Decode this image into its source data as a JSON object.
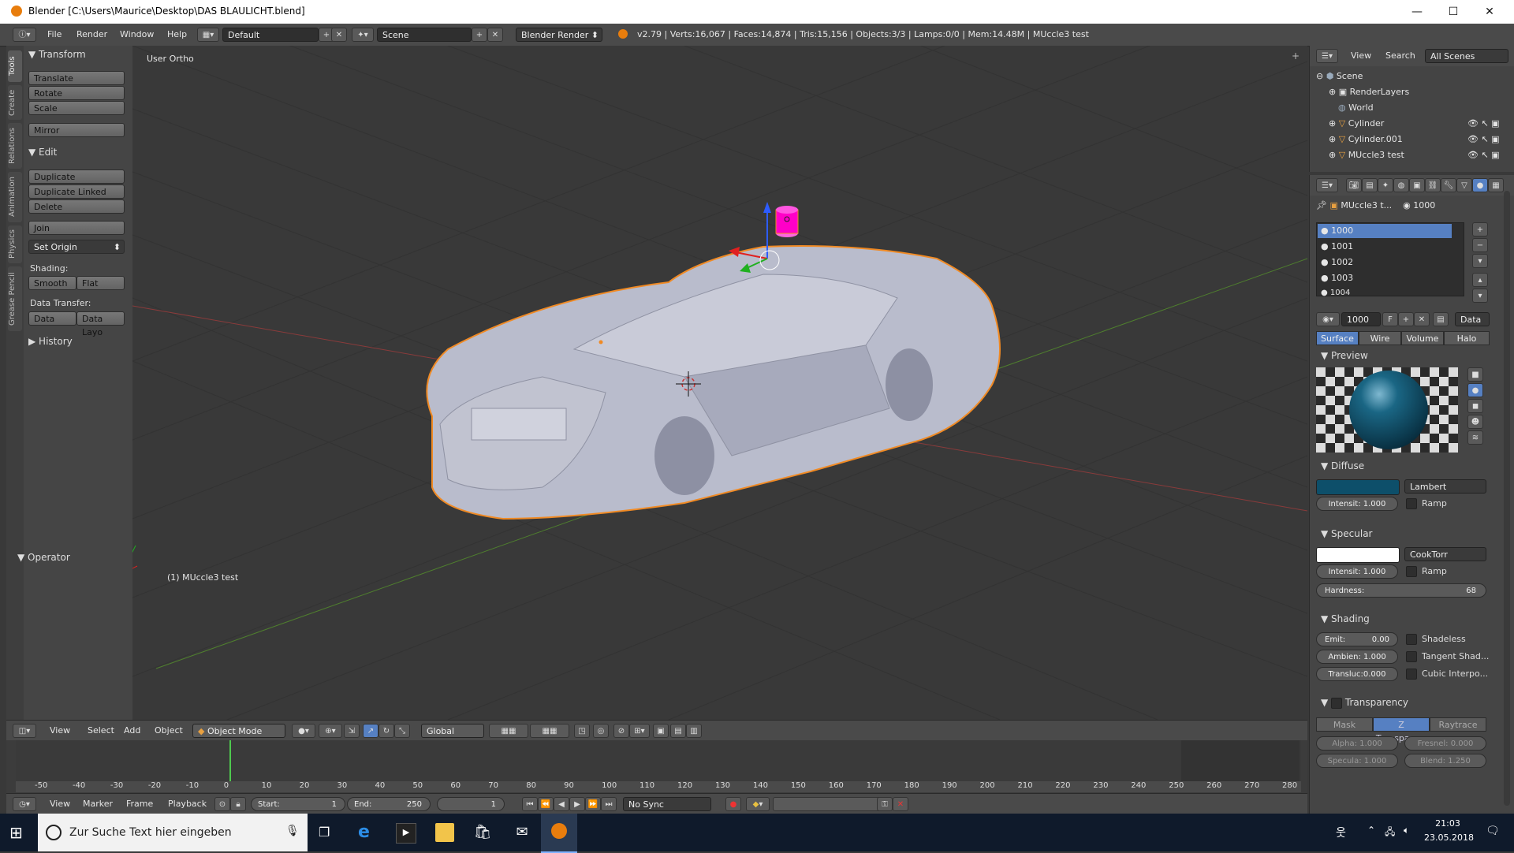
{
  "window": {
    "title": "Blender [C:\\Users\\Maurice\\Desktop\\DAS BLAULICHT.blend]",
    "minimize": "—",
    "maximize": "☐",
    "close": "✕"
  },
  "info_header": {
    "menus": [
      "File",
      "Render",
      "Window",
      "Help"
    ],
    "layout": "Default",
    "scene": "Scene",
    "engine": "Blender Render",
    "stats": "v2.79 | Verts:16,067 | Faces:14,874 | Tris:15,156 | Objects:3/3 | Lamps:0/0 | Mem:14.48M | MUccle3 test"
  },
  "tool_tabs": [
    "Tools",
    "Create",
    "Relations",
    "Animation",
    "Physics",
    "Grease Pencil"
  ],
  "tool_shelf": {
    "transform_title": "Transform",
    "translate": "Translate",
    "rotate": "Rotate",
    "scale": "Scale",
    "mirror": "Mirror",
    "edit_title": "Edit",
    "duplicate": "Duplicate",
    "duplicate_linked": "Duplicate Linked",
    "delete": "Delete",
    "join": "Join",
    "set_origin": "Set Origin",
    "shading_label": "Shading:",
    "smooth": "Smooth",
    "flat": "Flat",
    "data_transfer_label": "Data Transfer:",
    "data": "Data",
    "data_layout": "Data Layo",
    "history_title": "History",
    "operator_title": "Operator"
  },
  "viewport": {
    "view_label": "User Ortho",
    "object_label": "(1) MUccle3 test"
  },
  "view3d_header": {
    "menus": [
      "View",
      "Select",
      "Add",
      "Object"
    ],
    "mode": "Object Mode",
    "orientation": "Global"
  },
  "timeline": {
    "ticks": [
      "-50",
      "-40",
      "-30",
      "-20",
      "-10",
      "0",
      "10",
      "20",
      "30",
      "40",
      "50",
      "60",
      "70",
      "80",
      "90",
      "100",
      "110",
      "120",
      "130",
      "140",
      "150",
      "160",
      "170",
      "180",
      "190",
      "200",
      "210",
      "220",
      "230",
      "240",
      "250",
      "260",
      "270",
      "280"
    ],
    "current_frame_tick": "0",
    "menus": [
      "View",
      "Marker",
      "Frame",
      "Playback"
    ],
    "start_label": "Start:",
    "start_value": "1",
    "end_label": "End:",
    "end_value": "250",
    "current": "1",
    "sync": "No Sync"
  },
  "outliner": {
    "menus": [
      "View",
      "Search"
    ],
    "filter": "All Scenes",
    "items": [
      "Scene",
      "RenderLayers",
      "World",
      "Cylinder",
      "Cylinder.001",
      "MUccle3 test"
    ]
  },
  "properties": {
    "context_object": "MUccle3 t...",
    "context_material": "1000",
    "material_slots": [
      "1000",
      "1001",
      "1002",
      "1003",
      "1004"
    ],
    "material_name": "1000",
    "users_flag": "F",
    "data_select": "Data",
    "tabs": [
      "Surface",
      "Wire",
      "Volume",
      "Halo"
    ],
    "preview_title": "Preview",
    "diffuse_title": "Diffuse",
    "diffuse_color": "#0d4f6a",
    "diffuse_shader": "Lambert",
    "diffuse_intensity": "Intensit: 1.000",
    "ramp": "Ramp",
    "specular_title": "Specular",
    "specular_color": "#ffffff",
    "specular_shader": "CookTorr",
    "specular_intensity": "Intensit: 1.000",
    "hardness_label": "Hardness:",
    "hardness_value": "68",
    "shading_title": "Shading",
    "emit": "Emit:",
    "emit_value": "0.00",
    "ambient": "Ambien: 1.000",
    "translucency": "Transluc:0.000",
    "shadeless": "Shadeless",
    "tangent": "Tangent Shad...",
    "cubic": "Cubic Interpo...",
    "transparency_title": "Transparency",
    "transp_modes": [
      "Mask",
      "Z Transpare...",
      "Raytrace"
    ],
    "alpha": "Alpha:  1.000",
    "fresnel": "Fresnel: 0.000",
    "specular_alpha": "Specula: 1.000",
    "blend": "Blend:  1.250"
  },
  "taskbar": {
    "search_placeholder": "Zur Suche Text hier eingeben",
    "time": "21:03",
    "date": "23.05.2018"
  },
  "colors": {
    "accent_blue": "#5680c2",
    "beacon_magenta": "#ff00c8",
    "selection_outline": "#f08a24"
  }
}
